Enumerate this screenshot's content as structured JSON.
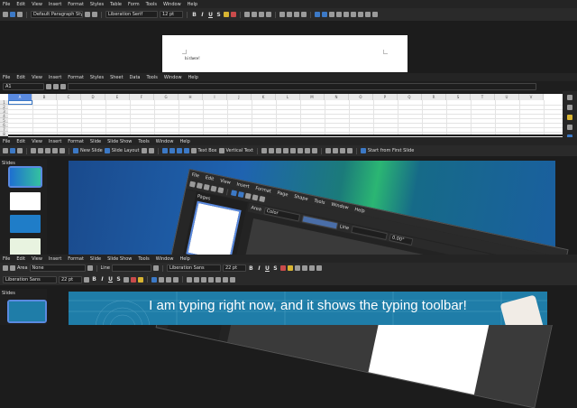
{
  "writer": {
    "menu": [
      "File",
      "Edit",
      "View",
      "Insert",
      "Format",
      "Styles",
      "Table",
      "Form",
      "Tools",
      "Window",
      "Help"
    ],
    "paragraph_style": "Default Paragraph Style",
    "font_name": "Liberation Serif",
    "font_size": "12 pt",
    "doc_text": "hi there!"
  },
  "calc": {
    "menu": [
      "File",
      "Edit",
      "View",
      "Insert",
      "Format",
      "Styles",
      "Sheet",
      "Data",
      "Tools",
      "Window",
      "Help"
    ],
    "name_box": "A1",
    "columns": [
      "A",
      "B",
      "C",
      "D",
      "E",
      "F",
      "G",
      "H",
      "I",
      "J",
      "K",
      "L",
      "M",
      "N",
      "O",
      "P",
      "Q",
      "R",
      "S",
      "T",
      "U",
      "V"
    ],
    "rows": [
      "1",
      "2",
      "3",
      "4",
      "5",
      "6",
      "7",
      "8"
    ]
  },
  "impress": {
    "menu": [
      "File",
      "Edit",
      "View",
      "Insert",
      "Format",
      "Slide",
      "Slide Show",
      "Tools",
      "Window",
      "Help"
    ],
    "toolbar": {
      "new_slide": "New Slide",
      "slide_layout": "Slide Layout",
      "text_box": "Text Box",
      "vertical_text": "Vertical Text",
      "start_first": "Start from First Slide"
    },
    "slides_title": "Slides"
  },
  "draw": {
    "menu": [
      "File",
      "Edit",
      "View",
      "Insert",
      "Format",
      "Page",
      "Shape",
      "Tools",
      "Window",
      "Help"
    ],
    "pages_title": "Pages",
    "area_label": "Area",
    "area_value": "Color",
    "line_label": "Line",
    "angle_value": "0.00°"
  },
  "impress2": {
    "menu": [
      "File",
      "Edit",
      "View",
      "Insert",
      "Format",
      "Slide",
      "Slide Show",
      "Tools",
      "Window",
      "Help"
    ],
    "area_label": "Area",
    "area_value": "None",
    "line_label": "Line",
    "font_name": "Liberation Sans",
    "font_size": "22 pt",
    "font_name_2": "Liberation Sans",
    "font_size_2": "22 pt",
    "slides_title": "Slides",
    "caption": "I am typing right now, and it shows the typing toolbar!"
  },
  "colors": {
    "accent": "#3c79c6",
    "background": "#1c1c1c",
    "slide_blue": "#1f7da8"
  }
}
